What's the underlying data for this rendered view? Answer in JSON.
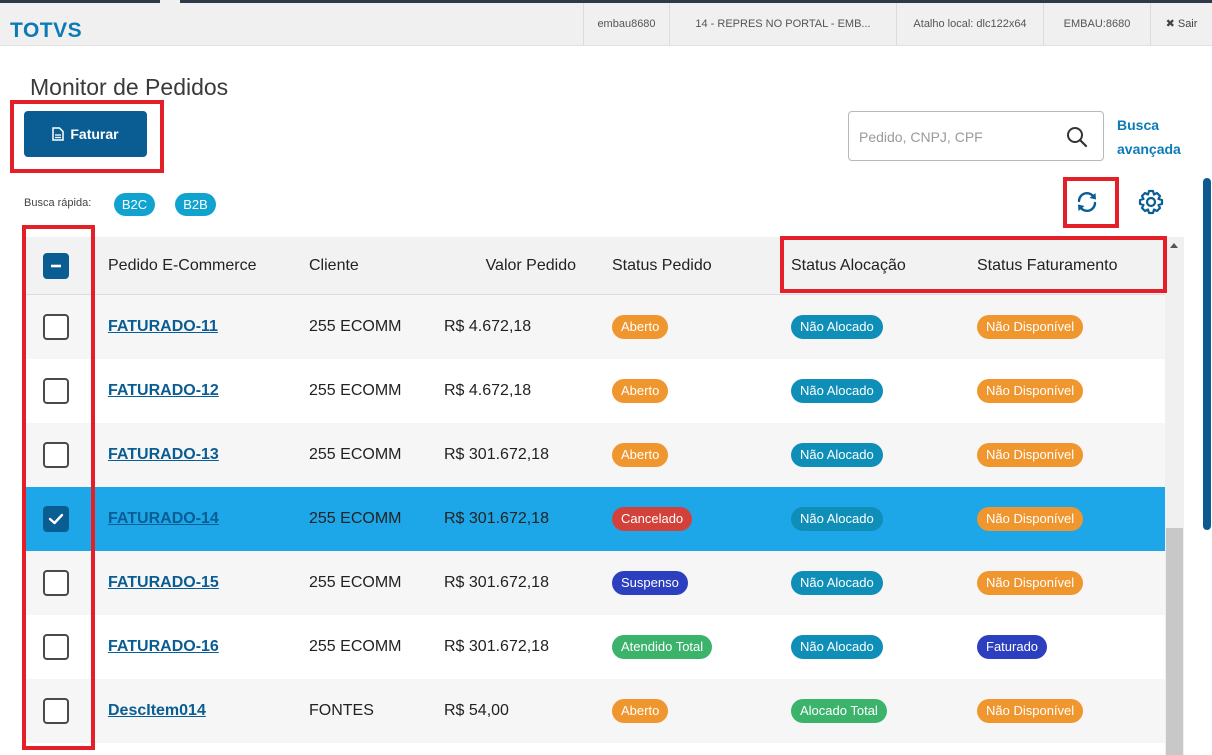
{
  "header": {
    "brand": "TOTVS",
    "items": [
      {
        "label": "embau8680"
      },
      {
        "label": "14 - REPRES NO PORTAL - EMB..."
      },
      {
        "label": "Atalho local: dlc122x64"
      },
      {
        "label": "EMBAU:8680"
      },
      {
        "label": "✖ Sair"
      }
    ]
  },
  "page": {
    "title": "Monitor de Pedidos",
    "faturar_label": "Faturar"
  },
  "search": {
    "placeholder": "Pedido, CNPJ, CPF",
    "value": "",
    "advanced_line1": "Busca",
    "advanced_line2": "avançada"
  },
  "quick_filter": {
    "label": "Busca rápida:",
    "chips": [
      "B2C",
      "B2B"
    ]
  },
  "table": {
    "columns": [
      "Pedido E-Commerce",
      "Cliente",
      "Valor Pedido",
      "Status Pedido",
      "Status Alocação",
      "Status Faturamento"
    ],
    "rows": [
      {
        "pedido": "FATURADO-11",
        "cliente": "255 ECOMM",
        "valor": "R$ 4.672,18",
        "status_pedido": "Aberto",
        "status_alocacao": "Não Alocado",
        "status_faturamento": "Não Disponível",
        "checked": false
      },
      {
        "pedido": "FATURADO-12",
        "cliente": "255 ECOMM",
        "valor": "R$ 4.672,18",
        "status_pedido": "Aberto",
        "status_alocacao": "Não Alocado",
        "status_faturamento": "Não Disponível",
        "checked": false
      },
      {
        "pedido": "FATURADO-13",
        "cliente": "255 ECOMM",
        "valor": "R$ 301.672,18",
        "status_pedido": "Aberto",
        "status_alocacao": "Não Alocado",
        "status_faturamento": "Não Disponível",
        "checked": false
      },
      {
        "pedido": "FATURADO-14",
        "cliente": "255 ECOMM",
        "valor": "R$ 301.672,18",
        "status_pedido": "Cancelado",
        "status_alocacao": "Não Alocado",
        "status_faturamento": "Não Disponível",
        "checked": true
      },
      {
        "pedido": "FATURADO-15",
        "cliente": "255 ECOMM",
        "valor": "R$ 301.672,18",
        "status_pedido": "Suspenso",
        "status_alocacao": "Não Alocado",
        "status_faturamento": "Não Disponível",
        "checked": false
      },
      {
        "pedido": "FATURADO-16",
        "cliente": "255 ECOMM",
        "valor": "R$ 301.672,18",
        "status_pedido": "Atendido Total",
        "status_alocacao": "Não Alocado",
        "status_faturamento": "Faturado",
        "checked": false
      },
      {
        "pedido": "DescItem014",
        "cliente": "FONTES",
        "valor": "R$ 54,00",
        "status_pedido": "Aberto",
        "status_alocacao": "Alocado Total",
        "status_faturamento": "Não Disponível",
        "checked": false
      }
    ]
  },
  "colors": {
    "primary": "#0a5d93",
    "brand": "#0c7ab7",
    "selected_row": "#1ea7e8",
    "highlight_border": "#e32028",
    "Aberto": "#f0962f",
    "Cancelado": "#d2413a",
    "Suspenso": "#2b3fbf",
    "Atendido Total": "#3bb36b",
    "Não Alocado": "#0f8fb7",
    "Alocado Total": "#3bb36b",
    "Não Disponível": "#f0962f",
    "Faturado": "#2b3fbf"
  },
  "icons": {
    "faturar": "document-icon",
    "search": "search-icon",
    "refresh": "refresh-icon",
    "settings": "gear-icon",
    "check": "checkmark-icon",
    "indeterminate": "minus-icon"
  }
}
